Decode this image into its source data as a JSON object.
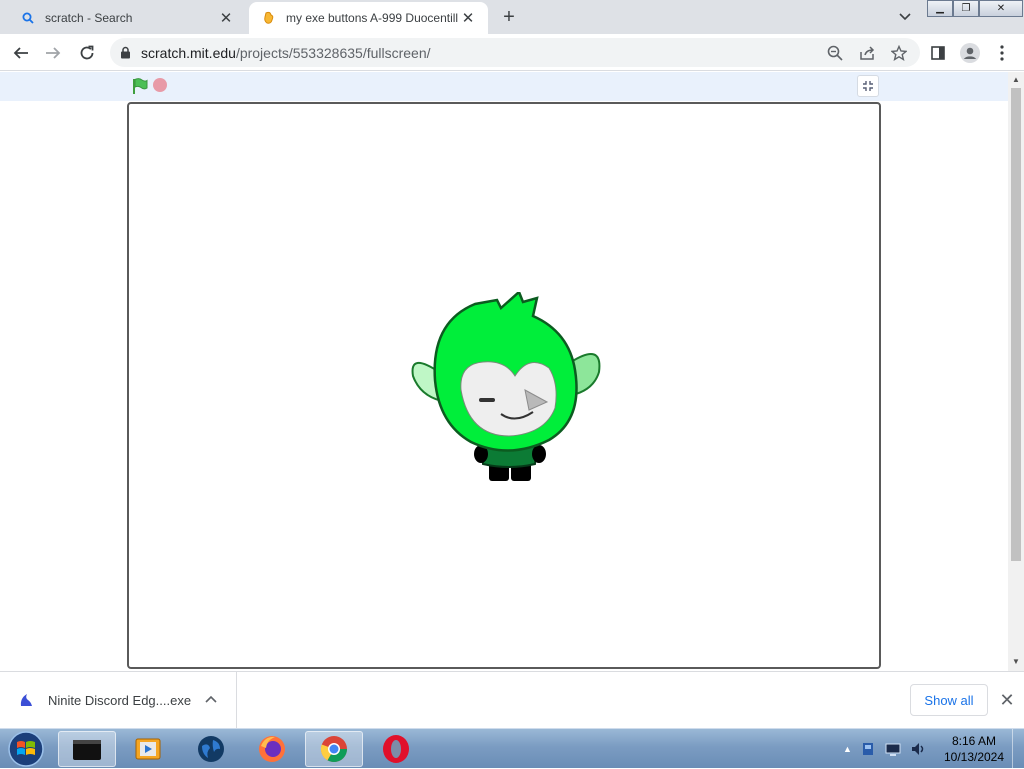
{
  "browser": {
    "tabs": [
      {
        "title": "scratch - Search",
        "favicon": "search-icon",
        "active": false
      },
      {
        "title": "my exe buttons A-999 Duocentill",
        "favicon": "scratch-icon",
        "active": true
      }
    ],
    "url": {
      "host": "scratch.mit.edu",
      "path": "/projects/553328635/fullscreen/"
    }
  },
  "scratch": {
    "controls": {
      "green_flag": "green-flag-icon",
      "stop": "stop-icon",
      "unfullscreen": "unfullscreen-icon"
    },
    "sprite": "green-haired-character"
  },
  "downloads": {
    "item": {
      "name": "Ninite Discord Edg....exe"
    },
    "show_all_label": "Show all"
  },
  "taskbar": {
    "apps": [
      "terminal-icon",
      "media-player-icon",
      "globe-icon",
      "firefox-icon",
      "chrome-icon",
      "opera-icon"
    ],
    "clock": {
      "time": "8:16 AM",
      "date": "10/13/2024"
    }
  },
  "colors": {
    "accent": "#1a73e8",
    "sprite_green": "#00ee3a",
    "tabstrip": "#dee1e6"
  }
}
